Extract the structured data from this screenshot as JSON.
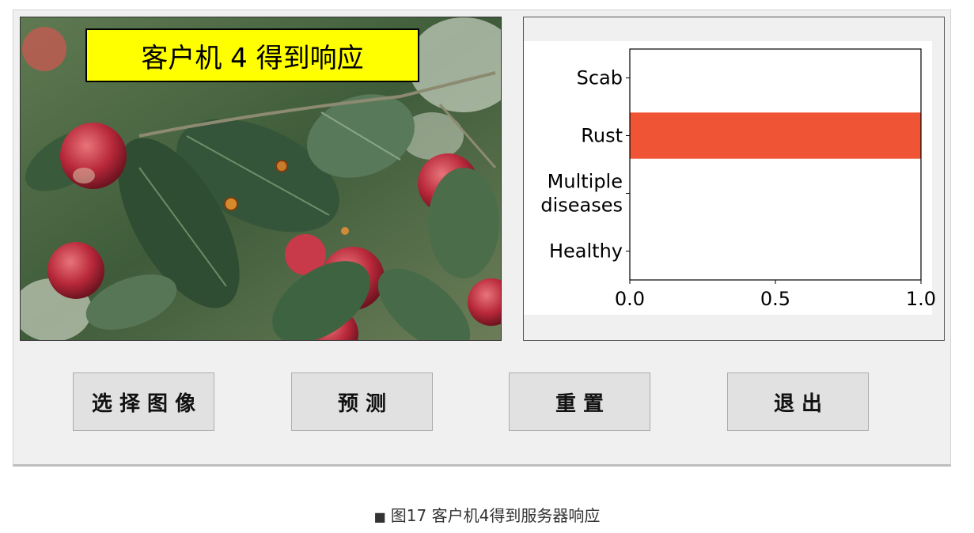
{
  "image_panel": {
    "banner_text": "客户机 4 得到响应"
  },
  "buttons": {
    "select_image": "选 择 图 像",
    "predict": "预  测",
    "reset": "重  置",
    "exit": "退  出"
  },
  "caption": {
    "bullet": "■",
    "text": "图17 客户机4得到服务器响应"
  },
  "chart_data": {
    "type": "bar",
    "orientation": "horizontal",
    "categories": [
      "Scab",
      "Rust",
      "Multiple diseases",
      "Healthy"
    ],
    "category_lines": [
      [
        "Scab"
      ],
      [
        "Rust"
      ],
      [
        "Multiple",
        "diseases"
      ],
      [
        "Healthy"
      ]
    ],
    "values": [
      0.0,
      1.0,
      0.0,
      0.0
    ],
    "xlim": [
      0,
      1.0
    ],
    "xticks": [
      "0.0",
      "0.5",
      "1.0"
    ],
    "bar_color": "#ef5535",
    "grid": false
  }
}
